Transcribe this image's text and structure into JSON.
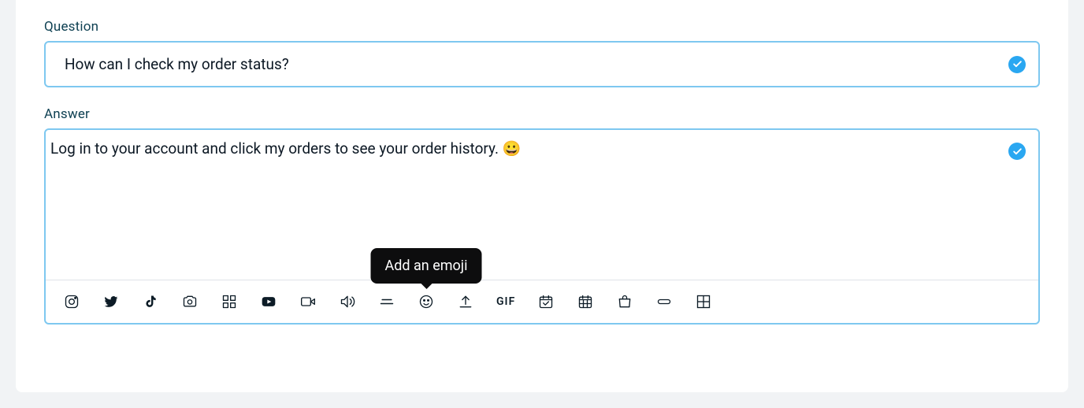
{
  "question": {
    "label": "Question",
    "value": "How can I check my order status?"
  },
  "answer": {
    "label": "Answer",
    "value": "Log in to your account and click my orders to see your order history. 😀"
  },
  "tooltip": {
    "text": "Add an emoji"
  },
  "toolbar": {
    "gif_label": "GIF"
  }
}
